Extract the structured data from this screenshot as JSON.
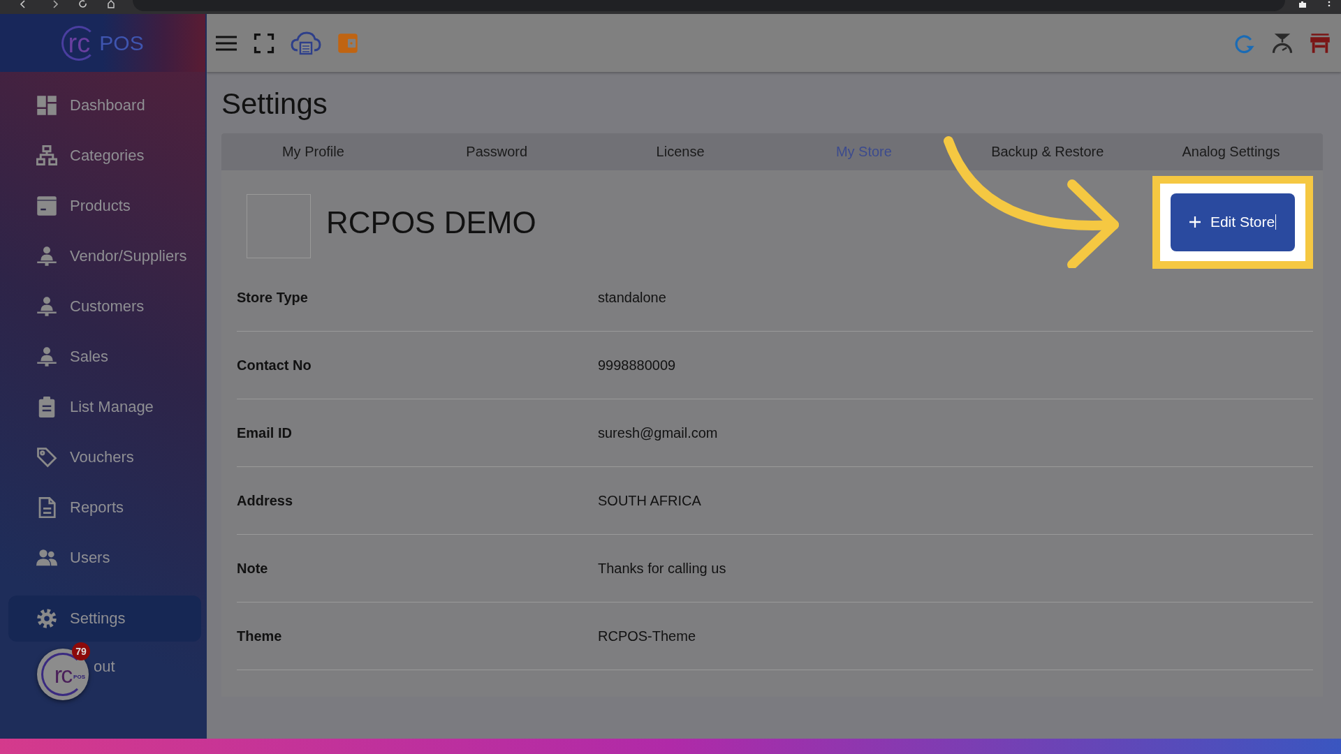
{
  "logo": {
    "mark": "rc",
    "text": "POS"
  },
  "sidebar": {
    "items": [
      {
        "label": "Dashboard",
        "selected": false
      },
      {
        "label": "Categories",
        "selected": false
      },
      {
        "label": "Products",
        "selected": false
      },
      {
        "label": "Vendor/Suppliers",
        "selected": false
      },
      {
        "label": "Customers",
        "selected": false
      },
      {
        "label": "Sales",
        "selected": false
      },
      {
        "label": "List Manage",
        "selected": false
      },
      {
        "label": "Vouchers",
        "selected": false
      },
      {
        "label": "Reports",
        "selected": false
      },
      {
        "label": "Users",
        "selected": false
      },
      {
        "label": "Settings",
        "selected": true
      },
      {
        "label": "out",
        "selected": false
      }
    ]
  },
  "floating_bubble": {
    "mark": "rc",
    "sub": "POS",
    "badge": "79"
  },
  "page_title": "Settings",
  "tabs": [
    {
      "label": "My Profile",
      "selected": false
    },
    {
      "label": "Password",
      "selected": false
    },
    {
      "label": "License",
      "selected": false
    },
    {
      "label": "My Store",
      "selected": true
    },
    {
      "label": "Backup & Restore",
      "selected": false
    },
    {
      "label": "Analog Settings",
      "selected": false
    }
  ],
  "store": {
    "name": "RCPOS DEMO",
    "edit_button": "Edit Store",
    "highlighted": true
  },
  "details": [
    {
      "label": "Store Type",
      "value": "standalone"
    },
    {
      "label": "Contact No",
      "value": "9998880009"
    },
    {
      "label": "Email ID",
      "value": "suresh@gmail.com"
    },
    {
      "label": "Address",
      "value": "SOUTH AFRICA"
    },
    {
      "label": "Note",
      "value": "Thanks for calling us"
    },
    {
      "label": "Theme",
      "value": "RCPOS-Theme"
    }
  ]
}
